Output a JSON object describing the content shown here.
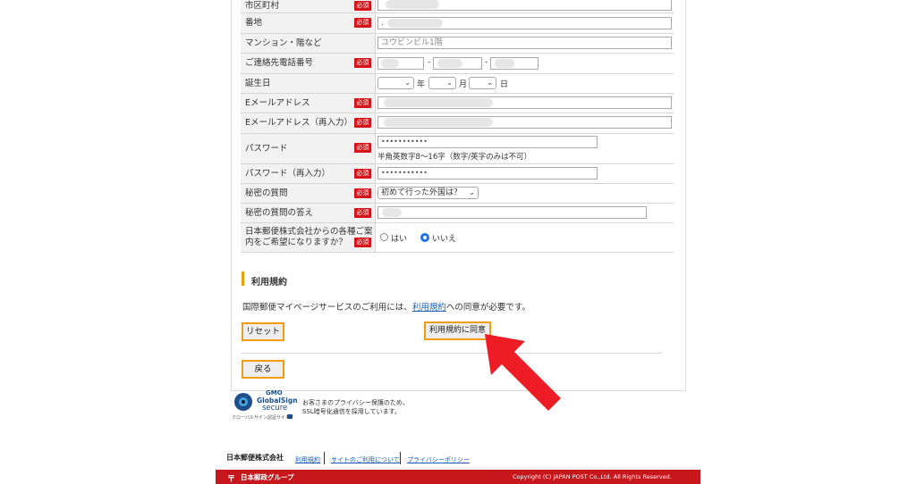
{
  "form": {
    "required_badge": "必須",
    "rows": {
      "city": {
        "label": "市区町村"
      },
      "address": {
        "label": "番地",
        "value": "."
      },
      "building": {
        "label": "マンション・階など",
        "value": "ユウビンビル1階"
      },
      "phone": {
        "label": "ご連絡先電話番号",
        "sep1": "-",
        "sep2": "-"
      },
      "birthday": {
        "label": "誕生日",
        "year_unit": "年",
        "month_unit": "月",
        "day_unit": "日"
      },
      "email": {
        "label": "Eメールアドレス"
      },
      "email_confirm": {
        "label": "Eメールアドレス（再入力）"
      },
      "password": {
        "label": "パスワード",
        "value": "•••••••••••",
        "hint": "半角英数字8～16字（数字/英字のみは不可）"
      },
      "password_confirm": {
        "label": "パスワード（再入力）",
        "value": "•••••••••••"
      },
      "secret_question": {
        "label": "秘密の質問",
        "value": "初めて行った外国は？"
      },
      "secret_answer": {
        "label": "秘密の質問の答え"
      },
      "newsletter": {
        "label_line1": "日本郵便株式会社からの各種ご案",
        "label_line2": "内をご希望になりますか？",
        "option_yes": "はい",
        "option_no": "いいえ",
        "selected": "いいえ"
      }
    }
  },
  "terms": {
    "heading": "利用規約",
    "text_before": "国際郵便マイページサービスのご利用には、",
    "link": "利用規約",
    "text_after": "への同意が必要です。",
    "reset_button": "リセット",
    "agree_button": "利用規約に同意",
    "back_button": "戻る"
  },
  "security": {
    "logo_line1": "GMO",
    "logo_line2": "GlobalSign",
    "logo_line3": "secure",
    "logo_caption": "クローバルサイン認証サイト",
    "message_line1": "お客さまのプライバシー保護のため、",
    "message_line2": "SSL暗号化通信を採用しています。"
  },
  "footer": {
    "company": "日本郵便株式会社",
    "links": [
      "利用規約",
      "サイトのご利用について",
      "プライバシーポリシー"
    ],
    "group_label": "日本郵政グループ",
    "copyright": "Copyright (C) JAPAN POST Co.,Ltd.  All Rights Reserved."
  },
  "colors": {
    "required_red": "#d7141a",
    "button_border": "#f39c12",
    "footer_red": "#c8161d",
    "link_blue": "#1a5fb4",
    "arrow_red": "#ee1c24"
  }
}
